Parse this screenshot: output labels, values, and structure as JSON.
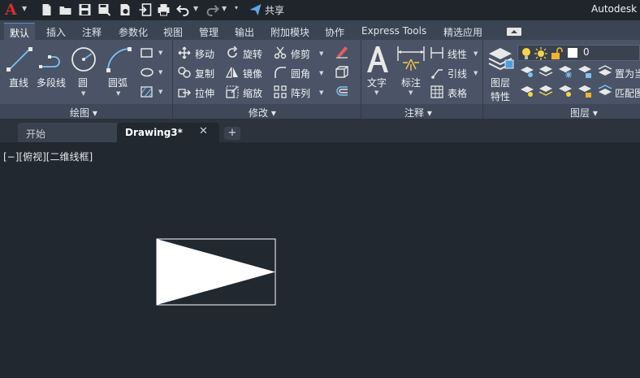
{
  "app": {
    "logo_letter": "A",
    "title": "Autodesk",
    "share_label": "共享"
  },
  "ribbon_tabs": [
    "默认",
    "插入",
    "注释",
    "参数化",
    "视图",
    "管理",
    "输出",
    "附加模块",
    "协作",
    "Express Tools",
    "精选应用"
  ],
  "panels": {
    "draw": {
      "label": "绘图 ▾",
      "line": "直线",
      "polyline": "多段线",
      "circle": "圆",
      "arc": "圆弧"
    },
    "modify": {
      "label": "修改 ▾",
      "move": "移动",
      "rotate": "旋转",
      "trim": "修剪",
      "copy": "复制",
      "mirror": "镜像",
      "fillet": "圆角",
      "stretch": "拉伸",
      "scale": "缩放",
      "array": "阵列"
    },
    "annotation": {
      "label": "注释 ▾",
      "text": "文字",
      "dimension": "标注",
      "linear": "线性",
      "leader": "引线",
      "table": "表格"
    },
    "layers": {
      "label": "图层 ▾",
      "properties_line1": "图层",
      "properties_line2": "特性",
      "current_layer": "0",
      "set_current": "置为当",
      "match": "匹配图"
    }
  },
  "doc_tabs": {
    "start": "开始",
    "current": "Drawing3*",
    "close": "✕",
    "add": "+"
  },
  "viewport": {
    "label": "[−][俯视][二维线框]"
  },
  "colors": {
    "accent": "#5b87c4",
    "logo": "#d32f2f",
    "canvas": "#212830",
    "ribbon": "#4a5466"
  }
}
